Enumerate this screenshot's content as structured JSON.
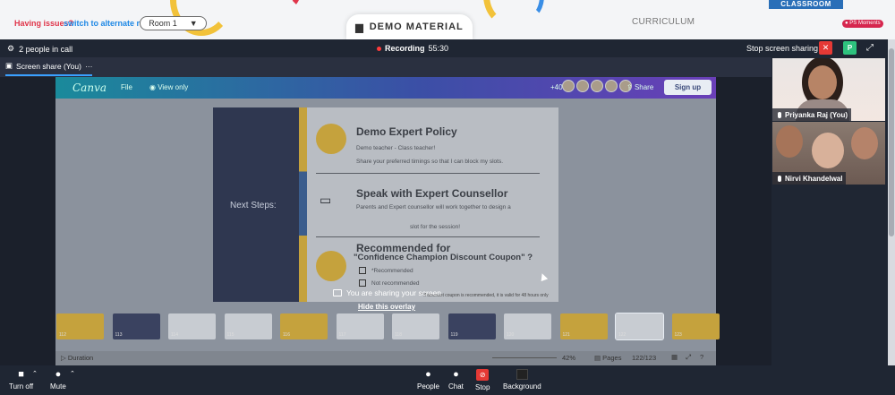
{
  "banner": {
    "issue_text": "Having issues?",
    "alt_room_link": "switch to alternate room",
    "room_select": "Room 1",
    "demo_tab": "DEMO MATERIAL",
    "curriculum_tab": "CURRICULUM",
    "classroom_label": "CLASSROOM",
    "ps_badge": "PS Moments"
  },
  "callbar": {
    "people_count": "2 people in call",
    "recording_label": "Recording",
    "recording_time": "55:30",
    "stop_share": "Stop screen sharing",
    "x_label": "✕",
    "p_label": "P",
    "expand_label": "⤢"
  },
  "tabstrip": {
    "tab_label": "Screen share (You)",
    "more": "···"
  },
  "canva": {
    "logo": "Canva",
    "file": "File",
    "view_only": "View only",
    "collaborators": "+40",
    "share": "Share",
    "sign_up": "Sign up",
    "duration": "Duration",
    "zoom": "42%",
    "pages": "Pages",
    "page_number": "122/123"
  },
  "slide": {
    "left_title": "Next Steps:",
    "h1": "Demo Expert Policy",
    "t1": "Demo teacher - Class teacher!",
    "t2": "Share your preferred timings so that I can block my slots.",
    "h2": "Speak with Expert Counsellor",
    "t3": "Parents and Expert counsellor will work together to design a",
    "t4": "slot for the session!",
    "h3": "Recommended for",
    "h3b": "\"Confidence Champion Discount Coupon\" ?",
    "opt1": "*Recommended",
    "opt2": "Not recommended",
    "note": "* if discount coupon is recommended, it is valid for 48 hours only"
  },
  "overlay": {
    "message": "You are sharing your screen",
    "hide": "Hide this overlay"
  },
  "thumbnails": [
    "112",
    "113",
    "114",
    "115",
    "116",
    "117",
    "118",
    "119",
    "120",
    "121",
    "122",
    "123"
  ],
  "participants": [
    {
      "name": "Priyanka Raj (You)"
    },
    {
      "name": "Nirvi Khandelwal"
    }
  ],
  "controls": {
    "turn_off": "Turn off",
    "mute": "Mute",
    "people": "People",
    "chat": "Chat",
    "stop": "Stop",
    "background": "Background"
  },
  "colors": {
    "recording": "#ff3b3b",
    "stop_red": "#e53935",
    "p_green": "#2ec27e",
    "accent_blue": "#3aa0ff"
  }
}
